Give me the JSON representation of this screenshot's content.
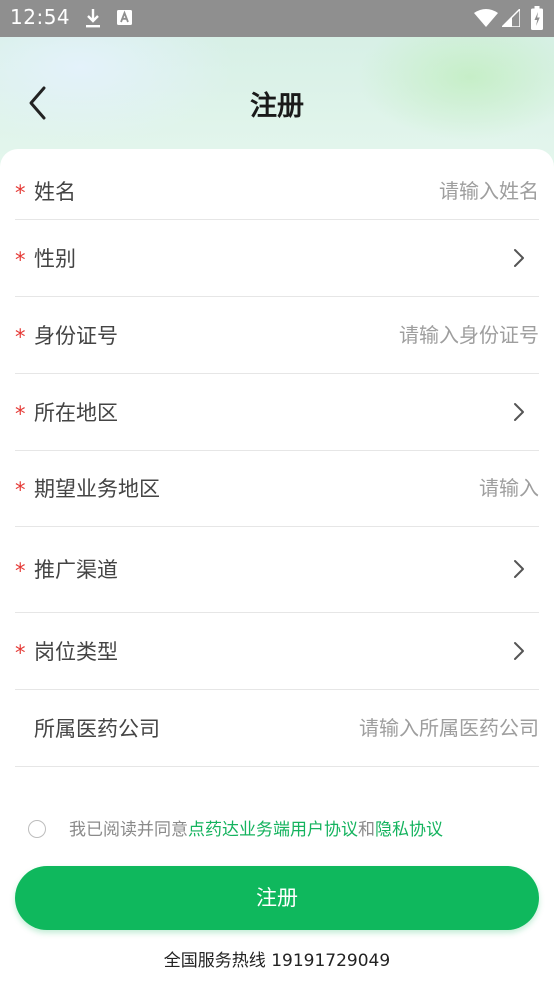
{
  "status_bar": {
    "time": "12:54",
    "icons": [
      "download-icon",
      "a-notification-icon",
      "wifi-icon",
      "signal-icon",
      "battery-icon"
    ]
  },
  "header": {
    "title": "注册",
    "back_icon": "chevron-left-icon"
  },
  "form": {
    "rows": [
      {
        "label": "姓名",
        "required": true,
        "type": "input",
        "placeholder": "请输入姓名",
        "value": ""
      },
      {
        "label": "性别",
        "required": true,
        "type": "select"
      },
      {
        "label": "身份证号",
        "required": true,
        "type": "input",
        "placeholder": "请输入身份证号",
        "value": ""
      },
      {
        "label": "所在地区",
        "required": true,
        "type": "select"
      },
      {
        "label": "期望业务地区",
        "required": true,
        "type": "input",
        "placeholder": "请输入",
        "value": ""
      },
      {
        "label": "推广渠道",
        "required": true,
        "type": "select"
      },
      {
        "label": "岗位类型",
        "required": true,
        "type": "select"
      },
      {
        "label": "所属医药公司",
        "required": false,
        "type": "input",
        "placeholder": "请输入所属医药公司",
        "value": ""
      }
    ],
    "required_mark": "*"
  },
  "agreement": {
    "checked": false,
    "prefix": "我已阅读并同意",
    "link1": "点药达业务端用户协议",
    "conjunction": "和",
    "link2": "隐私协议"
  },
  "submit_label": "注册",
  "hotline": "全国服务热线 19191729049",
  "colors": {
    "accent": "#0fb85d",
    "required": "#e53935",
    "link": "#14b35e"
  }
}
